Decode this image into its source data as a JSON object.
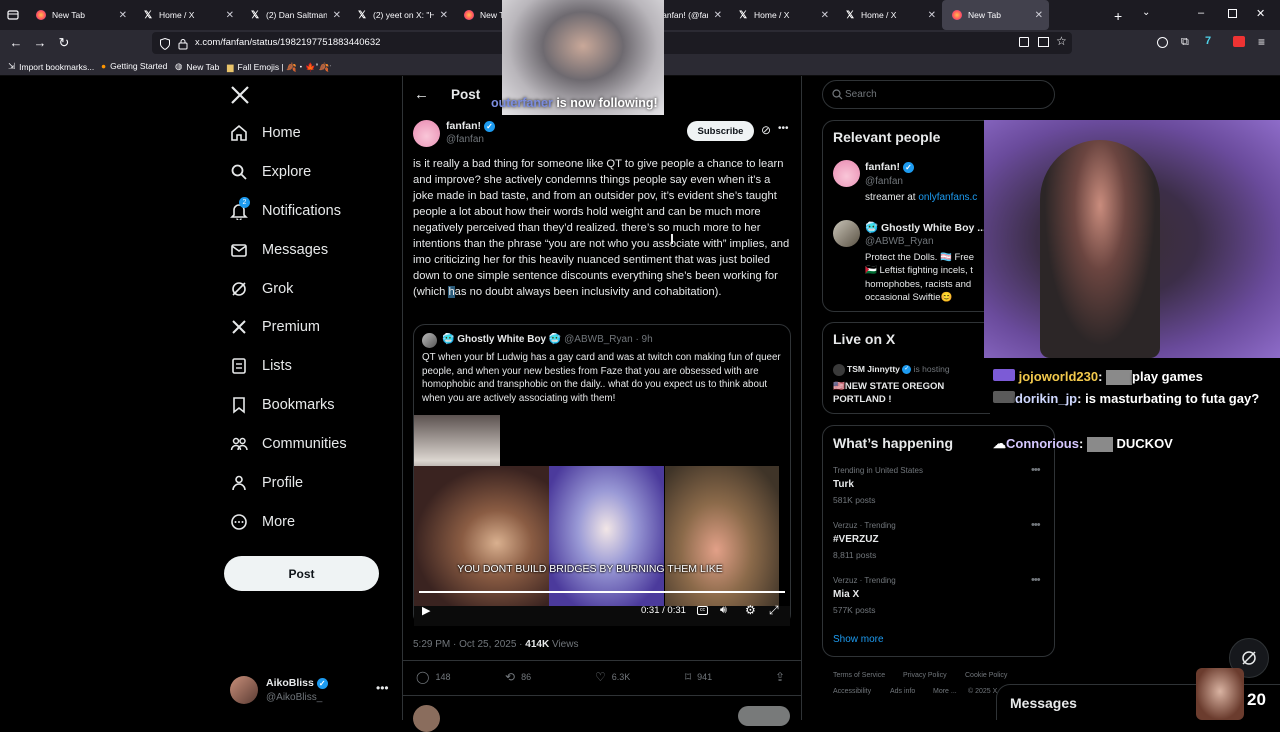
{
  "browser": {
    "tabs": [
      {
        "title": "New Tab",
        "icon": "firefox-icon"
      },
      {
        "title": "Home / X",
        "icon": "x-icon"
      },
      {
        "title": "(2) Dan Saltman on",
        "icon": "x-icon"
      },
      {
        "title": "(2) yeet on X: \"Has",
        "icon": "x-icon"
      },
      {
        "title": "New T",
        "icon": "firefox-icon"
      },
      {
        "title": "",
        "icon": ""
      },
      {
        "title": "(2) fanfan! (@fanfan",
        "icon": "x-icon"
      },
      {
        "title": "Home / X",
        "icon": "x-icon"
      },
      {
        "title": "Home / X",
        "icon": "x-icon"
      },
      {
        "title": "New Tab",
        "icon": "firefox-icon"
      }
    ],
    "url": "x.com/fanfan/status/1982197751883440632",
    "bookmarks": [
      "Import bookmarks...",
      "Getting Started",
      "New Tab",
      "Fall Emojis | 🍂・🍁˚🍂ˑ"
    ]
  },
  "sidebar": {
    "items": [
      {
        "label": "Home",
        "icon": "home-icon"
      },
      {
        "label": "Explore",
        "icon": "search-icon"
      },
      {
        "label": "Notifications",
        "icon": "bell-icon",
        "badge": "2"
      },
      {
        "label": "Messages",
        "icon": "mail-icon"
      },
      {
        "label": "Grok",
        "icon": "grok-icon"
      },
      {
        "label": "Premium",
        "icon": "x-icon"
      },
      {
        "label": "Lists",
        "icon": "list-icon"
      },
      {
        "label": "Bookmarks",
        "icon": "bookmark-icon"
      },
      {
        "label": "Communities",
        "icon": "people-icon"
      },
      {
        "label": "Profile",
        "icon": "person-icon"
      },
      {
        "label": "More",
        "icon": "more-icon"
      }
    ],
    "post_label": "Post",
    "account": {
      "name": "AikoBliss",
      "handle": "@AikoBliss_"
    }
  },
  "main": {
    "header": "Post",
    "author": {
      "name": "fanfan!",
      "handle": "@fanfan"
    },
    "subscribe_label": "Subscribe",
    "text_parts": {
      "a": "is it really a bad thing for someone like QT to give people a chance to learn and improve? she actively condemns things people say even when it’s a joke made in bad taste, and from an outsider pov, it’s evident she’s taught people a lot about how their words hold weight and can be much more negatively perceived than they’d realized. there’s so much more to her intentions than the phrase “you are not who you associate with” implies, and imo criticizing her for this heavily nuanced sentiment that was just boiled down to one simple sentence discounts everything she’s been working for (which ",
      "b": "h",
      "c": "as no doubt always been inclusivity and cohabitation)."
    },
    "quote": {
      "name": "🥶 Ghostly White Boy 🥶",
      "handle": "@ABWB_Ryan",
      "time": "· 9h",
      "text": "QT when your bf Ludwig has a gay card and was at twitch con making fun of queer people, and when your new besties from Faze that you are obsessed with are homophobic and transphobic on the daily.. what do you expect us to think about when you are actively associating with them!",
      "caption": "YOU DONT BUILD BRIDGES BY BURNING THEM LIKE",
      "video_time": "0:31 / 0:31",
      "progress": 1.0
    },
    "meta": {
      "time": "5:29 PM · Oct 25, 2025 ·",
      "views": "414K",
      "views_label": "Views"
    },
    "actions": {
      "replies": "148",
      "reposts": "86",
      "likes": "6.3K",
      "bookmarks": "941"
    }
  },
  "right": {
    "search_placeholder": "Search",
    "relevant_title": "Relevant people",
    "people": [
      {
        "name": "fanfan!",
        "handle": "@fanfan",
        "bio_prefix": "streamer at ",
        "bio_link": "onlyfanfans.c"
      },
      {
        "name": "🥶 Ghostly White Boy ...",
        "handle": "@ABWB_Ryan",
        "bio": "Protect the Dolls. 🏳️‍⚧️ Free 🇵🇸 Leftist fighting incels, t homophobes, racists and occasional Swiftie😊"
      }
    ],
    "live_title": "Live on X",
    "live": {
      "name": "TSM Jinnytty",
      "status": "is hosting",
      "title": "🇺🇸NEW STATE OREGON PORTLAND !"
    },
    "happening_title": "What’s happening",
    "trends": [
      {
        "meta": "Trending in United States",
        "title": "Turk",
        "count": "581K posts"
      },
      {
        "meta": "Verzuz · Trending",
        "title": "#VERZUZ",
        "count": "8,811 posts"
      },
      {
        "meta": "Verzuz · Trending",
        "title": "Mia X",
        "count": "577K posts"
      }
    ],
    "show_more": "Show more",
    "footer": [
      "Terms of Service",
      "Privacy Policy",
      "Cookie Policy",
      "Accessibility",
      "Ads info",
      "More ...",
      "© 2025 X"
    ]
  },
  "overlay": {
    "follow_name": "outerfaner",
    "follow_text": "is now following!",
    "chat": [
      {
        "user": "jojoworld230",
        "msg": "play games"
      },
      {
        "user": "dorikin_jp",
        "msg": "is masturbating to futa gay?"
      },
      {
        "user": "Connorious",
        "msg": "DUCKOV"
      }
    ],
    "messages_label": "Messages",
    "counter": "20"
  },
  "colors": {
    "accent": "#1d9bf0",
    "bg": "#000000",
    "border": "#2f3336",
    "muted": "#71767b",
    "chat_user": "#f2c94c"
  }
}
